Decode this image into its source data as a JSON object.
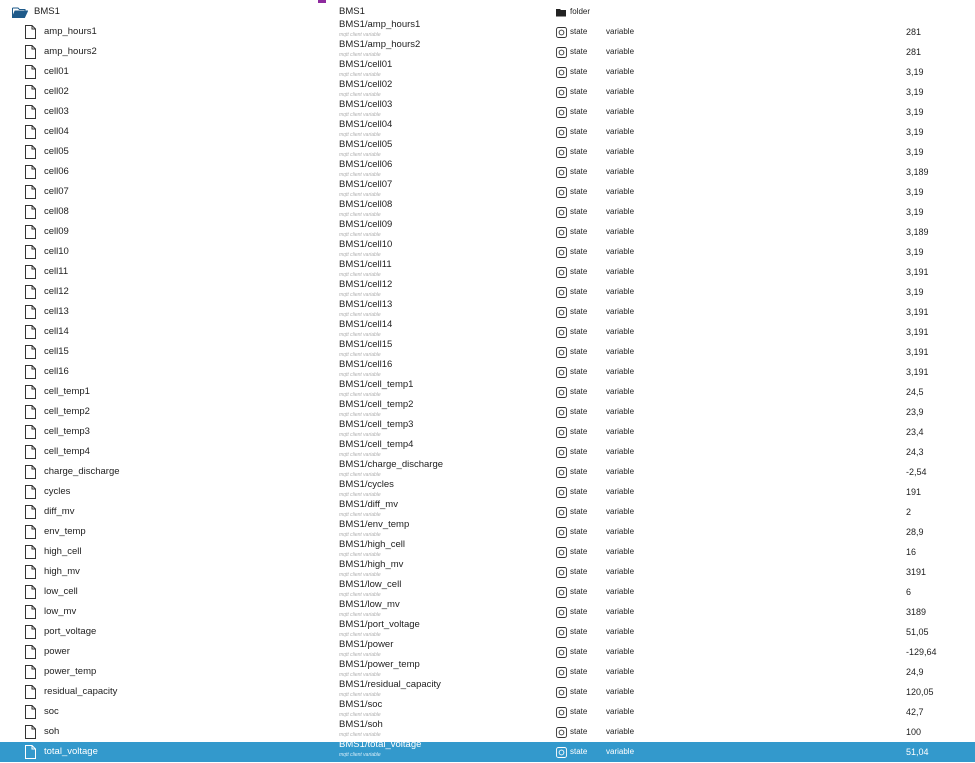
{
  "colors": {
    "selected_row": "#3399cc",
    "folder_icon": "#1e5a8a",
    "accent_mark": "#8e2a9e"
  },
  "root": {
    "name": "BMS1",
    "id": "BMS1",
    "type": "folder",
    "name_icon": "folder-open-icon",
    "type_icon": "folder-icon"
  },
  "file_icon": "file-icon",
  "state_icon": "state-circle-icon",
  "rows": [
    {
      "name": "amp_hours1",
      "id": "BMS1/amp_hours1",
      "desc": "mqtt client variable",
      "type": "state",
      "role": "variable",
      "value": "281"
    },
    {
      "name": "amp_hours2",
      "id": "BMS1/amp_hours2",
      "desc": "mqtt client variable",
      "type": "state",
      "role": "variable",
      "value": "281"
    },
    {
      "name": "cell01",
      "id": "BMS1/cell01",
      "desc": "mqtt client variable",
      "type": "state",
      "role": "variable",
      "value": "3,19"
    },
    {
      "name": "cell02",
      "id": "BMS1/cell02",
      "desc": "mqtt client variable",
      "type": "state",
      "role": "variable",
      "value": "3,19"
    },
    {
      "name": "cell03",
      "id": "BMS1/cell03",
      "desc": "mqtt client variable",
      "type": "state",
      "role": "variable",
      "value": "3,19"
    },
    {
      "name": "cell04",
      "id": "BMS1/cell04",
      "desc": "mqtt client variable",
      "type": "state",
      "role": "variable",
      "value": "3,19"
    },
    {
      "name": "cell05",
      "id": "BMS1/cell05",
      "desc": "mqtt client variable",
      "type": "state",
      "role": "variable",
      "value": "3,19"
    },
    {
      "name": "cell06",
      "id": "BMS1/cell06",
      "desc": "mqtt client variable",
      "type": "state",
      "role": "variable",
      "value": "3,189"
    },
    {
      "name": "cell07",
      "id": "BMS1/cell07",
      "desc": "mqtt client variable",
      "type": "state",
      "role": "variable",
      "value": "3,19"
    },
    {
      "name": "cell08",
      "id": "BMS1/cell08",
      "desc": "mqtt client variable",
      "type": "state",
      "role": "variable",
      "value": "3,19"
    },
    {
      "name": "cell09",
      "id": "BMS1/cell09",
      "desc": "mqtt client variable",
      "type": "state",
      "role": "variable",
      "value": "3,189"
    },
    {
      "name": "cell10",
      "id": "BMS1/cell10",
      "desc": "mqtt client variable",
      "type": "state",
      "role": "variable",
      "value": "3,19"
    },
    {
      "name": "cell11",
      "id": "BMS1/cell11",
      "desc": "mqtt client variable",
      "type": "state",
      "role": "variable",
      "value": "3,191"
    },
    {
      "name": "cell12",
      "id": "BMS1/cell12",
      "desc": "mqtt client variable",
      "type": "state",
      "role": "variable",
      "value": "3,19"
    },
    {
      "name": "cell13",
      "id": "BMS1/cell13",
      "desc": "mqtt client variable",
      "type": "state",
      "role": "variable",
      "value": "3,191"
    },
    {
      "name": "cell14",
      "id": "BMS1/cell14",
      "desc": "mqtt client variable",
      "type": "state",
      "role": "variable",
      "value": "3,191"
    },
    {
      "name": "cell15",
      "id": "BMS1/cell15",
      "desc": "mqtt client variable",
      "type": "state",
      "role": "variable",
      "value": "3,191"
    },
    {
      "name": "cell16",
      "id": "BMS1/cell16",
      "desc": "mqtt client variable",
      "type": "state",
      "role": "variable",
      "value": "3,191"
    },
    {
      "name": "cell_temp1",
      "id": "BMS1/cell_temp1",
      "desc": "mqtt client variable",
      "type": "state",
      "role": "variable",
      "value": "24,5"
    },
    {
      "name": "cell_temp2",
      "id": "BMS1/cell_temp2",
      "desc": "mqtt client variable",
      "type": "state",
      "role": "variable",
      "value": "23,9"
    },
    {
      "name": "cell_temp3",
      "id": "BMS1/cell_temp3",
      "desc": "mqtt client variable",
      "type": "state",
      "role": "variable",
      "value": "23,4"
    },
    {
      "name": "cell_temp4",
      "id": "BMS1/cell_temp4",
      "desc": "mqtt client variable",
      "type": "state",
      "role": "variable",
      "value": "24,3"
    },
    {
      "name": "charge_discharge",
      "id": "BMS1/charge_discharge",
      "desc": "mqtt client variable",
      "type": "state",
      "role": "variable",
      "value": "-2,54"
    },
    {
      "name": "cycles",
      "id": "BMS1/cycles",
      "desc": "mqtt client variable",
      "type": "state",
      "role": "variable",
      "value": "191"
    },
    {
      "name": "diff_mv",
      "id": "BMS1/diff_mv",
      "desc": "mqtt client variable",
      "type": "state",
      "role": "variable",
      "value": "2"
    },
    {
      "name": "env_temp",
      "id": "BMS1/env_temp",
      "desc": "mqtt client variable",
      "type": "state",
      "role": "variable",
      "value": "28,9"
    },
    {
      "name": "high_cell",
      "id": "BMS1/high_cell",
      "desc": "mqtt client variable",
      "type": "state",
      "role": "variable",
      "value": "16"
    },
    {
      "name": "high_mv",
      "id": "BMS1/high_mv",
      "desc": "mqtt client variable",
      "type": "state",
      "role": "variable",
      "value": "3191"
    },
    {
      "name": "low_cell",
      "id": "BMS1/low_cell",
      "desc": "mqtt client variable",
      "type": "state",
      "role": "variable",
      "value": "6"
    },
    {
      "name": "low_mv",
      "id": "BMS1/low_mv",
      "desc": "mqtt client variable",
      "type": "state",
      "role": "variable",
      "value": "3189"
    },
    {
      "name": "port_voltage",
      "id": "BMS1/port_voltage",
      "desc": "mqtt client variable",
      "type": "state",
      "role": "variable",
      "value": "51,05"
    },
    {
      "name": "power",
      "id": "BMS1/power",
      "desc": "mqtt client variable",
      "type": "state",
      "role": "variable",
      "value": "-129,64"
    },
    {
      "name": "power_temp",
      "id": "BMS1/power_temp",
      "desc": "mqtt client variable",
      "type": "state",
      "role": "variable",
      "value": "24,9"
    },
    {
      "name": "residual_capacity",
      "id": "BMS1/residual_capacity",
      "desc": "mqtt client variable",
      "type": "state",
      "role": "variable",
      "value": "120,05"
    },
    {
      "name": "soc",
      "id": "BMS1/soc",
      "desc": "mqtt client variable",
      "type": "state",
      "role": "variable",
      "value": "42,7"
    },
    {
      "name": "soh",
      "id": "BMS1/soh",
      "desc": "mqtt client variable",
      "type": "state",
      "role": "variable",
      "value": "100"
    },
    {
      "name": "total_voltage",
      "id": "BMS1/total_voltage",
      "desc": "mqtt client variable",
      "type": "state",
      "role": "variable",
      "value": "51,04",
      "selected": true
    }
  ]
}
